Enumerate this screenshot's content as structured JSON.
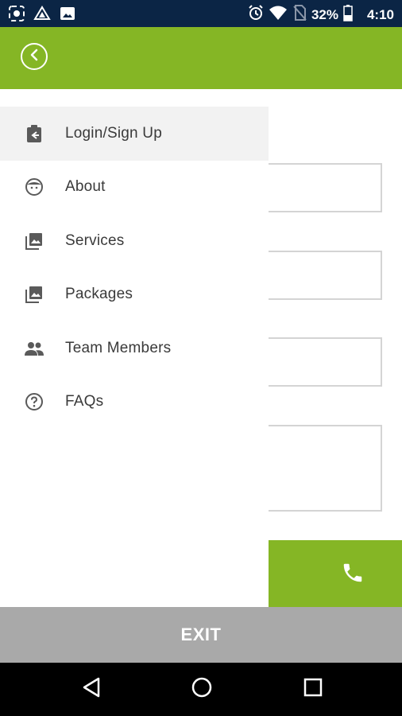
{
  "status_bar": {
    "battery": "32%",
    "time": "4:10",
    "left_icons": [
      "screen-record-icon",
      "drive-icon",
      "image-icon"
    ],
    "right_icons": [
      "alarm-icon",
      "wifi-icon",
      "no-sim-icon",
      "battery-icon"
    ]
  },
  "app_bar": {
    "color": "#85b625",
    "back_icon": "back-circle-icon"
  },
  "drawer": {
    "items": [
      {
        "label": "Login/Sign Up",
        "icon": "login-clipboard-icon",
        "active": true
      },
      {
        "label": "About",
        "icon": "face-icon",
        "active": false
      },
      {
        "label": "Services",
        "icon": "photo-library-icon",
        "active": false
      },
      {
        "label": "Packages",
        "icon": "photo-library-icon",
        "active": false
      },
      {
        "label": "Team Members",
        "icon": "people-icon",
        "active": false
      },
      {
        "label": "FAQs",
        "icon": "help-circle-icon",
        "active": false
      }
    ]
  },
  "call_button": {
    "icon": "phone-icon",
    "color": "#85b625"
  },
  "exit": {
    "label": "EXIT"
  },
  "nav_bar": {
    "icons": [
      "nav-back-icon",
      "nav-home-icon",
      "nav-recents-icon"
    ]
  }
}
